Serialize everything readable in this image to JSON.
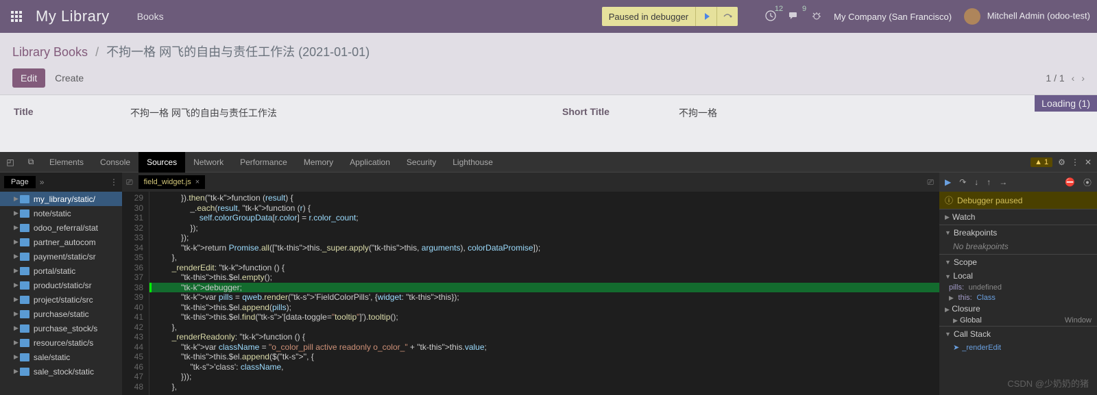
{
  "odoo": {
    "app_title": "My Library",
    "top_menu": "Books",
    "debugger_pill": "Paused in debugger",
    "clock_badge": "12",
    "chat_badge": "9",
    "company": "My Company (San Francisco)",
    "user": "Mitchell Admin (odoo-test)"
  },
  "breadcrumb": {
    "root": "Library Books",
    "sep": "/",
    "current": "不拘一格 网飞的自由与责任工作法 (2021-01-01)"
  },
  "actions": {
    "edit": "Edit",
    "create": "Create"
  },
  "pager": {
    "text": "1 / 1"
  },
  "fields": {
    "title_label": "Title",
    "title_value": "不拘一格 网飞的自由与责任工作法",
    "short_label": "Short Title",
    "short_value": "不拘一格"
  },
  "loading": "Loading (1)",
  "devtools": {
    "tabs": [
      "Elements",
      "Console",
      "Sources",
      "Network",
      "Performance",
      "Memory",
      "Application",
      "Security",
      "Lighthouse"
    ],
    "active_tab": "Sources",
    "warn_count": "1",
    "page_tab": "Page",
    "file_tree": [
      {
        "name": "my_library/static/",
        "sel": true
      },
      {
        "name": "note/static"
      },
      {
        "name": "odoo_referral/stat"
      },
      {
        "name": "partner_autocom"
      },
      {
        "name": "payment/static/sr"
      },
      {
        "name": "portal/static"
      },
      {
        "name": "product/static/sr"
      },
      {
        "name": "project/static/src"
      },
      {
        "name": "purchase/static"
      },
      {
        "name": "purchase_stock/s"
      },
      {
        "name": "resource/static/s"
      },
      {
        "name": "sale/static"
      },
      {
        "name": "sale_stock/static"
      }
    ],
    "open_file": "field_widget.js",
    "first_line_no": 29,
    "highlight_line": 38,
    "code_lines": [
      "            }).then(function (result) {",
      "                _.each(result, function (r) {",
      "                    self.colorGroupData[r.color] = r.color_count;",
      "                });",
      "            });",
      "            return Promise.all([this._super.apply(this, arguments), colorDataPromise]);",
      "        },",
      "        _renderEdit: function () {",
      "            this.$el.empty();",
      "            debugger;",
      "            var pills = qweb.render('FieldColorPills', {widget: this});",
      "            this.$el.append(pills);",
      "            this.$el.find('[data-toggle=\"tooltip\"]').tooltip();",
      "        },",
      "        _renderReadonly: function () {",
      "            var className = \"o_color_pill active readonly o_color_\" + this.value;",
      "            this.$el.append($('<span>', {",
      "                'class': className,",
      "            }));",
      "        },"
    ],
    "debugger": {
      "status": "Debugger paused",
      "watch": "Watch",
      "breakpoints": "Breakpoints",
      "no_bp": "No breakpoints",
      "scope": "Scope",
      "local": "Local",
      "pills_k": "pills:",
      "pills_v": "undefined",
      "this_k": "this:",
      "this_v": "Class",
      "closure": "Closure",
      "global": "Global",
      "global_v": "Window",
      "callstack": "Call Stack",
      "frame": "_renderEdit"
    }
  },
  "watermark": "CSDN @少奶奶的猪"
}
